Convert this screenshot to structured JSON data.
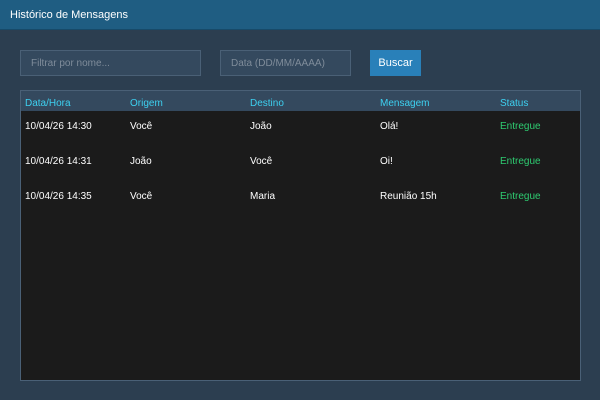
{
  "window": {
    "title": "Histórico de Mensagens"
  },
  "filters": {
    "name_placeholder": "Filtrar por nome...",
    "name_value": "",
    "date_placeholder": "Data (DD/MM/AAAA)",
    "date_value": "",
    "search_label": "Buscar"
  },
  "table": {
    "columns": [
      "Data/Hora",
      "Origem",
      "Destino",
      "Mensagem",
      "Status"
    ],
    "rows": [
      {
        "datetime": "10/04/26 14:30",
        "origin": "Você",
        "destination": "João",
        "message": "Olá!",
        "status": "Entregue"
      },
      {
        "datetime": "10/04/26 14:31",
        "origin": "João",
        "destination": "Você",
        "message": "Oi!",
        "status": "Entregue"
      },
      {
        "datetime": "10/04/26 14:35",
        "origin": "Você",
        "destination": "Maria",
        "message": "Reunião 15h",
        "status": "Entregue"
      }
    ]
  },
  "colors": {
    "background": "#2c3e50",
    "titlebar": "#1f5d82",
    "accent_button": "#2980b9",
    "header_text": "#3dd0f0",
    "status_ok": "#2ecc71",
    "table_bg": "#1b1b1b"
  }
}
